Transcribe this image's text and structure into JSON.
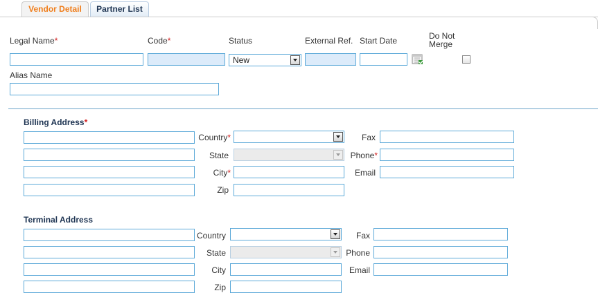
{
  "tabs": [
    {
      "label": "Vendor Detail",
      "active": true
    },
    {
      "label": "Partner List",
      "active": false
    }
  ],
  "header_fields": {
    "legal_name": {
      "label": "Legal Name",
      "required": "*",
      "value": ""
    },
    "code": {
      "label": "Code",
      "required": "*",
      "value": ""
    },
    "status": {
      "label": "Status",
      "value": "New"
    },
    "external_ref": {
      "label": "External Ref.",
      "value": ""
    },
    "start_date": {
      "label": "Start Date",
      "value": ""
    },
    "do_not_merge": {
      "label_line1": "Do Not",
      "label_line2": "Merge",
      "checked": false
    },
    "alias_name": {
      "label": "Alias Name",
      "value": ""
    }
  },
  "billing_address": {
    "title": "Billing Address",
    "required": "*",
    "country": {
      "label": "Country",
      "required": "*",
      "value": ""
    },
    "state": {
      "label": "State",
      "value": ""
    },
    "city": {
      "label": "City",
      "required": "*",
      "value": ""
    },
    "zip": {
      "label": "Zip",
      "value": ""
    },
    "fax": {
      "label": "Fax",
      "value": ""
    },
    "phone": {
      "label": "Phone",
      "required": "*",
      "value": ""
    },
    "email": {
      "label": "Email",
      "value": ""
    }
  },
  "terminal_address": {
    "title": "Terminal Address",
    "country": {
      "label": "Country",
      "value": ""
    },
    "state": {
      "label": "State",
      "value": ""
    },
    "city": {
      "label": "City",
      "value": ""
    },
    "zip": {
      "label": "Zip",
      "value": ""
    },
    "fax": {
      "label": "Fax",
      "value": ""
    },
    "phone": {
      "label": "Phone",
      "value": ""
    },
    "email": {
      "label": "Email",
      "value": ""
    }
  },
  "icons": {
    "date_picker": "calendar-icon",
    "dropdown": "chevron-down-icon"
  },
  "colors": {
    "active_tab_text": "#f07d1a",
    "section_title": "#1f3553",
    "required": "#d21d1d",
    "input_border": "#5aa8d8"
  }
}
